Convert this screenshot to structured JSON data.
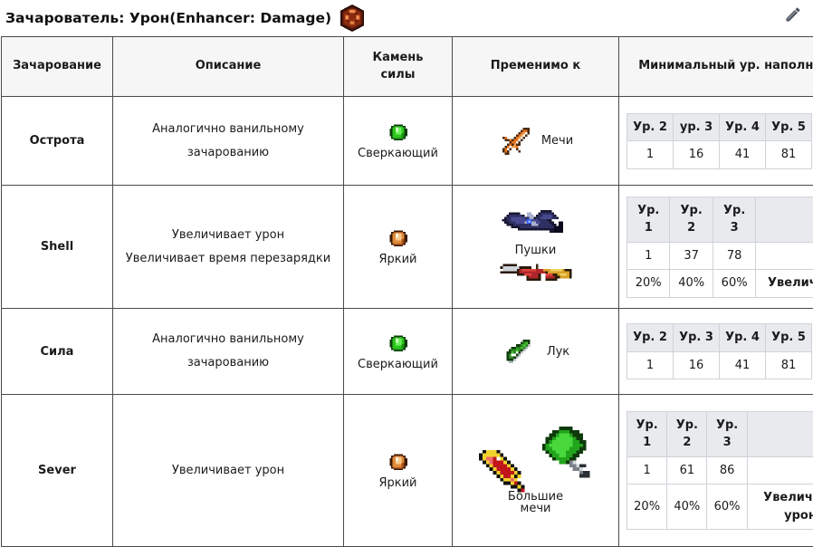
{
  "header": {
    "title": "Зачарователь: Урон(Enhancer: Damage)",
    "block_icon": "enhancer-damage-block-icon",
    "edit_icon": "pencil-edit-icon"
  },
  "table": {
    "columns": [
      "Зачарование",
      "Описание",
      "Камень\nсилы",
      "Применимо к",
      "Минимальный ур. наполнения:"
    ],
    "column_labels": {
      "enchantment": "Зачарование",
      "description": "Описание",
      "power_stone_line1": "Камень",
      "power_stone_line2": "силы",
      "applies_to": "Пременимо к",
      "min_fill_level": "Минимальный ур. наполнения:"
    },
    "rows": [
      {
        "name": "Острота",
        "description_lines": [
          "Аналогично ванильному",
          "зачарованию"
        ],
        "stone": {
          "label": "Сверкающий",
          "color": "#27d11a",
          "icon": "green-gem-icon"
        },
        "applies": [
          {
            "label": "Мечи",
            "icon": "iron-sword-icon"
          }
        ],
        "levels": {
          "headers": [
            "Ур. 2",
            "ур. 3",
            "Ур. 4",
            "Ур. 5"
          ],
          "values": [
            "1",
            "16",
            "41",
            "81"
          ],
          "percents": [],
          "note": ""
        }
      },
      {
        "name": "Shell",
        "description_lines": [
          "Увеличивает урон",
          "Увеличивает время перезарядки"
        ],
        "stone": {
          "label": "Яркий",
          "color": "#e08a4a",
          "icon": "orange-gem-icon"
        },
        "applies": [
          {
            "label": "Пушки",
            "icon": "blue-cannon-icon"
          },
          {
            "label": "",
            "icon": "rifle-icon"
          }
        ],
        "levels": {
          "headers": [
            "Ур. 1",
            "Ур. 2",
            "Ур. 3",
            ""
          ],
          "values": [
            "1",
            "37",
            "78",
            ""
          ],
          "percents": [
            "20%",
            "40%",
            "60%"
          ],
          "note": "Увеличение"
        }
      },
      {
        "name": "Сила",
        "description_lines": [
          "Аналогично ванильному",
          "зачарованию"
        ],
        "stone": {
          "label": "Сверкающий",
          "color": "#27d11a",
          "icon": "green-gem-icon"
        },
        "applies": [
          {
            "label": "Лук",
            "icon": "green-bow-icon"
          }
        ],
        "levels": {
          "headers": [
            "Ур. 2",
            "Ур. 3",
            "Ур. 4",
            "Ур. 5"
          ],
          "values": [
            "1",
            "16",
            "41",
            "81"
          ],
          "percents": [],
          "note": ""
        }
      },
      {
        "name": "Sever",
        "description_lines": [
          "Увеличивает урон"
        ],
        "stone": {
          "label": "Яркий",
          "color": "#e08a4a",
          "icon": "orange-gem-icon"
        },
        "applies": [
          {
            "label": "Большие",
            "icon": "red-greatsword-icon"
          },
          {
            "label": "мечи",
            "icon": "green-greatsword-icon"
          }
        ],
        "levels": {
          "headers": [
            "Ур.\n1",
            "Ур.\n2",
            "Ур.\n3",
            ""
          ],
          "headers_split": [
            [
              "Ур.",
              "1"
            ],
            [
              "Ур.",
              "2"
            ],
            [
              "Ур.",
              "3"
            ]
          ],
          "values": [
            "1",
            "61",
            "86",
            ""
          ],
          "percents": [
            "20%",
            "40%",
            "60%"
          ],
          "note": "Увеличение урона",
          "note_lines": [
            "Увеличение",
            "урона"
          ]
        }
      }
    ]
  },
  "colors": {
    "border": "#4a4a4a",
    "header_bg": "#f6f6f6",
    "inner_header_bg": "#e8eaed",
    "inner_border": "#cfd3d8",
    "text": "#1b1b1b"
  }
}
